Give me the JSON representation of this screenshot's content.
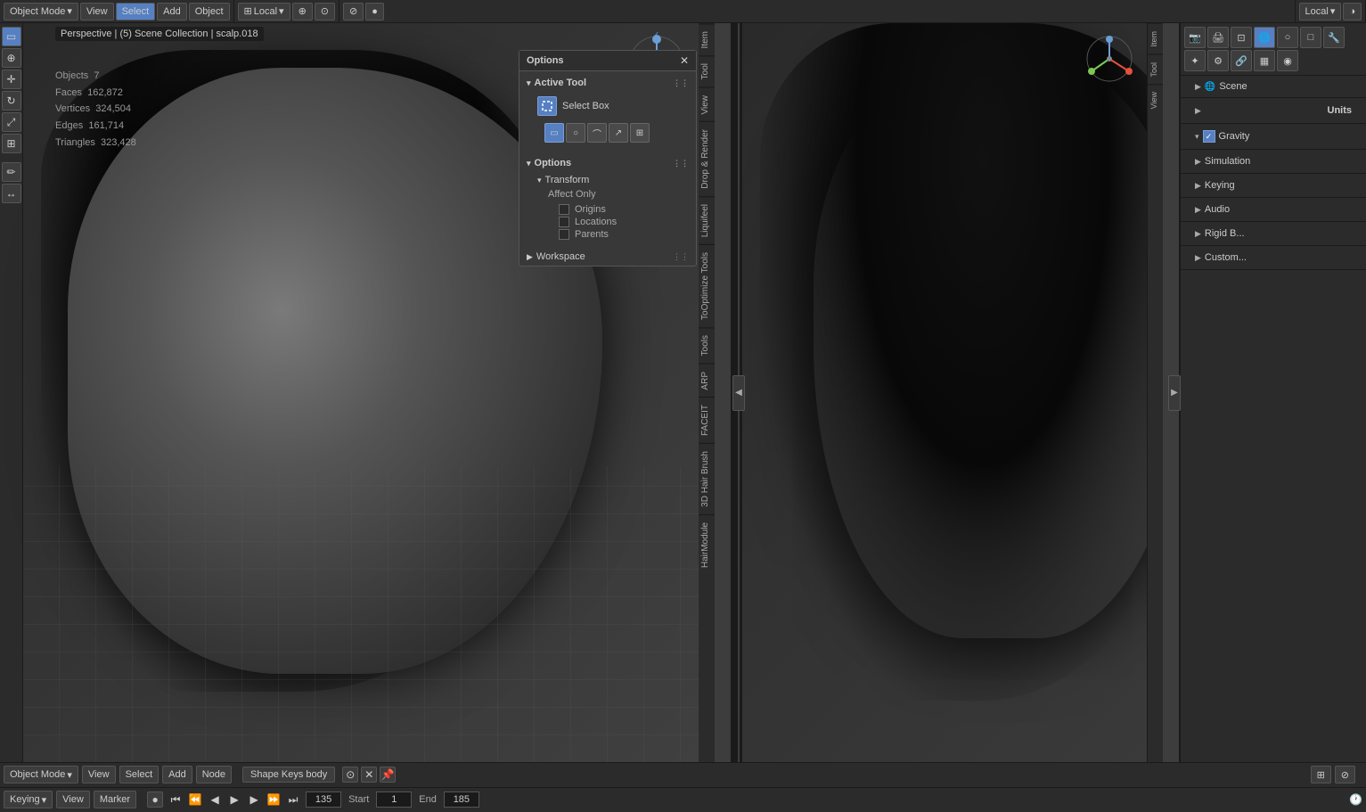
{
  "header": {
    "mode": "Object Mode",
    "view": "View",
    "select": "Select",
    "add": "Add",
    "object": "Object",
    "transform_orientation": "Local",
    "options_label": "Options",
    "close_symbol": "✕"
  },
  "viewport_left": {
    "mode_label": "Perspective",
    "scene_info": "(5) Scene Collection | scalp.018",
    "stats": {
      "objects_label": "Objects",
      "objects_val": "7",
      "faces_label": "Faces",
      "faces_val": "162,872",
      "vertices_label": "Vertices",
      "vertices_val": "324,504",
      "edges_label": "Edges",
      "edges_val": "161,714",
      "triangles_label": "Triangles",
      "triangles_val": "323,428"
    }
  },
  "options_panel": {
    "title": "Options",
    "active_tool_label": "Active Tool",
    "select_box_label": "Select Box",
    "options_section_label": "Options",
    "transform_label": "Transform",
    "affect_only_label": "Affect Only",
    "origins_label": "Origins",
    "locations_label": "Locations",
    "parents_label": "Parents",
    "workspace_label": "Workspace"
  },
  "side_tabs": {
    "item": "Item",
    "tool": "Tool",
    "view": "View",
    "drop_render": "Drop & Render",
    "liquifeel": "Liquifeel",
    "tooptimize": "ToOptimize Tools",
    "tools": "Tools",
    "arp": "ARP",
    "faceit": "FACEIT",
    "hair_brush": "3D Hair Brush",
    "hair_module": "HairModule"
  },
  "properties_panel": {
    "scene_label": "Scene",
    "scene_name": "Scene",
    "units_label": "Units",
    "gravity_label": "Gravity",
    "simulation_label": "Simulation",
    "keying_label": "Keying",
    "audio_label": "Audio",
    "rigid_body_label": "Rigid B...",
    "custom_label": "Custom..."
  },
  "bottom_bar": {
    "shape_keys_label": "Shape Keys body",
    "row2_mode": "Object Mode",
    "keying_label": "Keying",
    "view_label": "View",
    "marker_label": "Marker",
    "frame_current": "135",
    "start_label": "Start",
    "start_val": "1",
    "end_label": "End",
    "end_val": "185"
  },
  "tool_shelf": {
    "cursor_icon": "⊕",
    "move_icon": "✛",
    "rotate_icon": "↻",
    "scale_icon": "⤢",
    "transform_icon": "⊞",
    "annotate_icon": "✏",
    "measure_icon": "📏"
  },
  "nav_colors": {
    "x_color": "#e8503a",
    "y_color": "#7ec852",
    "z_color": "#6a9fd8",
    "gizmo_circle": "#888888"
  }
}
